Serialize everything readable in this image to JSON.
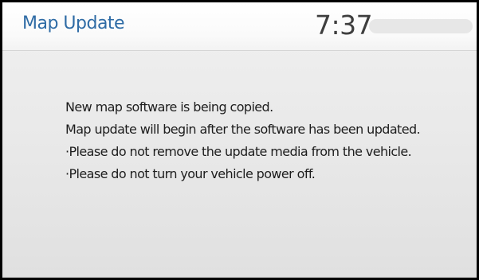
{
  "header": {
    "title": "Map Update",
    "clock": "7:37"
  },
  "message": {
    "lines": [
      "New map software is being copied.",
      "Map update will begin after the software has been updated.",
      "·Please do not remove the update media from the vehicle.",
      "·Please do not turn your vehicle power off."
    ]
  },
  "colors": {
    "title": "#2e6ba5",
    "clock": "#3e3e3e",
    "text": "#1d1d1d",
    "background": "#ebebeb",
    "frame": "#000000"
  }
}
